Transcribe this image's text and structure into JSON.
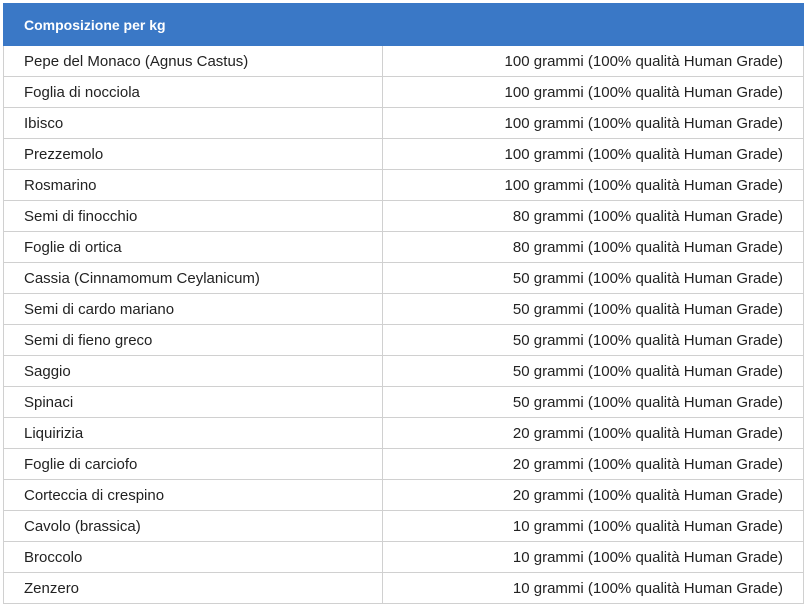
{
  "table": {
    "header": "Composizione per kg",
    "rows": [
      {
        "name": "Pepe del Monaco (Agnus Castus)",
        "amount": "100 grammi (100% qualità Human Grade)"
      },
      {
        "name": "Foglia di nocciola",
        "amount": "100 grammi (100% qualità Human Grade)"
      },
      {
        "name": "Ibisco",
        "amount": "100 grammi (100% qualità Human Grade)"
      },
      {
        "name": "Prezzemolo",
        "amount": "100 grammi (100% qualità Human Grade)"
      },
      {
        "name": "Rosmarino",
        "amount": "100 grammi (100% qualità Human Grade)"
      },
      {
        "name": "Semi di finocchio",
        "amount": "80 grammi (100% qualità Human Grade)"
      },
      {
        "name": "Foglie di ortica",
        "amount": "80 grammi (100% qualità Human Grade)"
      },
      {
        "name": "Cassia (Cinnamomum Ceylanicum)",
        "amount": "50 grammi (100% qualità Human Grade)"
      },
      {
        "name": "Semi di cardo mariano",
        "amount": "50 grammi (100% qualità Human Grade)"
      },
      {
        "name": "Semi di fieno greco",
        "amount": "50 grammi (100% qualità Human Grade)"
      },
      {
        "name": "Saggio",
        "amount": "50 grammi (100% qualità Human Grade)"
      },
      {
        "name": "Spinaci",
        "amount": "50 grammi (100% qualità Human Grade)"
      },
      {
        "name": "Liquirizia",
        "amount": "20 grammi (100% qualità Human Grade)"
      },
      {
        "name": "Foglie di carciofo",
        "amount": "20 grammi (100% qualità Human Grade)"
      },
      {
        "name": "Corteccia di crespino",
        "amount": "20 grammi (100% qualità Human Grade)"
      },
      {
        "name": "Cavolo (brassica)",
        "amount": "10 grammi (100% qualità Human Grade)"
      },
      {
        "name": "Broccolo",
        "amount": "10 grammi (100% qualità Human Grade)"
      },
      {
        "name": "Zenzero",
        "amount": "10 grammi (100% qualità Human Grade)"
      }
    ]
  }
}
